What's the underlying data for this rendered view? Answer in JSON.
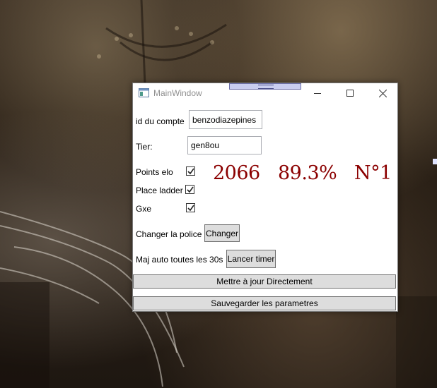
{
  "window": {
    "title": "MainWindow"
  },
  "form": {
    "account_label": "id du compte",
    "account_value": "benzodiazepines",
    "tier_label": "Tier:",
    "tier_value": "gen8ou",
    "points_label": "Points elo",
    "points_checked": true,
    "ladder_label": "Place ladder",
    "ladder_checked": true,
    "gxe_label": "Gxe",
    "gxe_checked": true,
    "font_label": "Changer la police",
    "font_button": "Changer",
    "timer_label": "Maj auto toutes les 30s",
    "timer_button": "Lancer timer",
    "update_button": "Mettre à jour Directement",
    "save_button": "Sauvegarder les parametres"
  },
  "stats": {
    "elo": "2066",
    "gxe": "89.3%",
    "rank": "N°1",
    "color": "#8b0000"
  },
  "icons": [
    "window-app-icon",
    "minimize-icon",
    "maximize-icon",
    "close-icon",
    "checkmark-icon",
    "resize-grip-icon"
  ]
}
